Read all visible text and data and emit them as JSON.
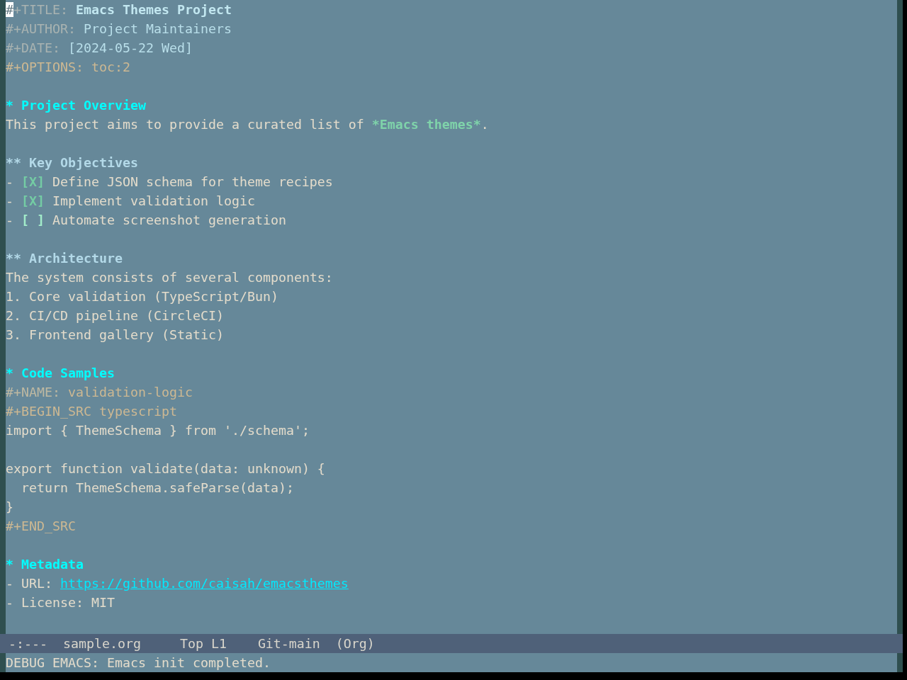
{
  "buffer": {
    "lines": [
      {
        "kind": "title",
        "cursor": true,
        "key": "#+TITLE:",
        "value": "Emacs Themes Project"
      },
      {
        "kind": "keyword",
        "cursor": false,
        "key": "#+AUTHOR:",
        "value": "Project Maintainers"
      },
      {
        "kind": "keyword",
        "cursor": false,
        "key": "#+DATE:",
        "value": "[2024-05-22 Wed]"
      },
      {
        "kind": "option",
        "cursor": false,
        "text": "#+OPTIONS: toc:2"
      },
      {
        "kind": "blank",
        "cursor": false
      },
      {
        "kind": "section",
        "cursor": false,
        "text": "* Project Overview"
      },
      {
        "kind": "paragraph",
        "cursor": false,
        "parts": [
          {
            "kind": "plain",
            "text": "This project aims to provide a curated list of "
          },
          {
            "kind": "bold",
            "text": "*Emacs themes*"
          },
          {
            "kind": "plain",
            "text": "."
          }
        ]
      },
      {
        "kind": "blank",
        "cursor": false
      },
      {
        "kind": "subsection",
        "cursor": false,
        "text": "** Key Objectives"
      },
      {
        "kind": "checkbox",
        "cursor": false,
        "bullet": "-",
        "box": "[X]",
        "checked": true,
        "text": "Define JSON schema for theme recipes"
      },
      {
        "kind": "checkbox",
        "cursor": false,
        "bullet": "-",
        "box": "[X]",
        "checked": true,
        "text": "Implement validation logic"
      },
      {
        "kind": "checkbox",
        "cursor": false,
        "bullet": "-",
        "box": "[ ]",
        "checked": false,
        "text": "Automate screenshot generation"
      },
      {
        "kind": "blank",
        "cursor": false
      },
      {
        "kind": "subsection",
        "cursor": false,
        "text": "** Architecture"
      },
      {
        "kind": "paragraph",
        "cursor": false,
        "parts": [
          {
            "kind": "plain",
            "text": "The system consists of several components:"
          }
        ]
      },
      {
        "kind": "list",
        "cursor": false,
        "text": "1. Core validation (TypeScript/Bun)"
      },
      {
        "kind": "list",
        "cursor": false,
        "text": "2. CI/CD pipeline (CircleCI)"
      },
      {
        "kind": "list",
        "cursor": false,
        "text": "3. Frontend gallery (Static)"
      },
      {
        "kind": "blank",
        "cursor": false
      },
      {
        "kind": "section",
        "cursor": false,
        "text": "* Code Samples"
      },
      {
        "kind": "name",
        "cursor": false,
        "key": "#+NAME:",
        "value": "validation-logic"
      },
      {
        "kind": "delimiter",
        "cursor": false,
        "text": "#+BEGIN_SRC typescript"
      },
      {
        "kind": "code",
        "cursor": false,
        "text": "import { ThemeSchema } from './schema';"
      },
      {
        "kind": "blank",
        "cursor": false
      },
      {
        "kind": "code",
        "cursor": false,
        "text": "export function validate(data: unknown) {"
      },
      {
        "kind": "code",
        "cursor": false,
        "text": "  return ThemeSchema.safeParse(data);"
      },
      {
        "kind": "code",
        "cursor": false,
        "text": "}"
      },
      {
        "kind": "delimiter",
        "cursor": false,
        "text": "#+END_SRC"
      },
      {
        "kind": "blank",
        "cursor": false
      },
      {
        "kind": "section",
        "cursor": false,
        "text": "* Metadata"
      },
      {
        "kind": "link",
        "cursor": false,
        "label": "- URL:",
        "url": "https://github.com/caisah/emacsthemes"
      },
      {
        "kind": "list",
        "cursor": false,
        "text": "- License: MIT"
      }
    ]
  },
  "mode_line": {
    "status": "-:---",
    "buffer_name": "sample.org",
    "position": "Top L1",
    "branch": "Git-main",
    "mode": "(Org)"
  },
  "echo_area": {
    "message": "DEBUG EMACS: Emacs init completed."
  }
}
